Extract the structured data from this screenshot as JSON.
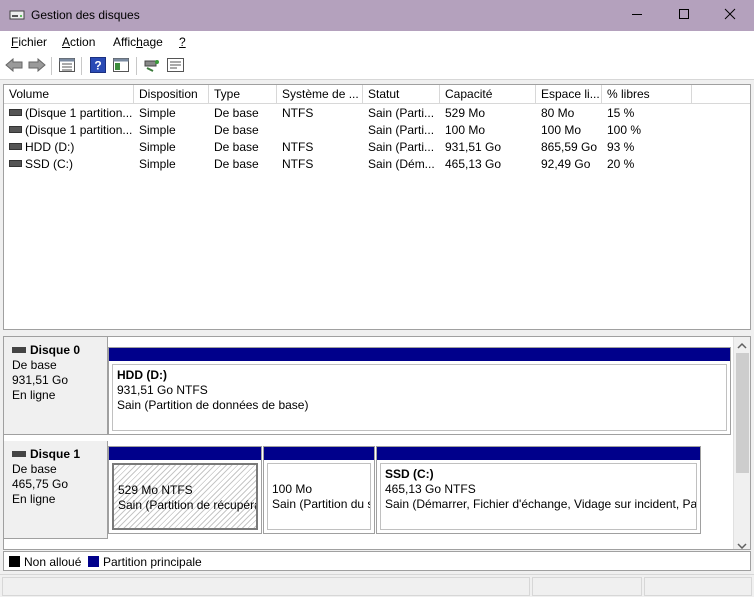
{
  "window": {
    "title": "Gestion des disques",
    "minimize_icon": "minimize-icon",
    "maximize_icon": "maximize-icon",
    "close_icon": "close-icon"
  },
  "menu": {
    "items": [
      {
        "first": "F",
        "rest": "ichier"
      },
      {
        "first": "A",
        "rest": "ction"
      },
      {
        "pre": "Affic",
        "first": "h",
        "rest": "age"
      },
      {
        "first": "?",
        "rest": ""
      }
    ]
  },
  "toolbar": {
    "icons": [
      "back-arrow-icon",
      "forward-arrow-icon",
      "list-view-icon",
      "help-icon",
      "properties-pane-icon",
      "rescan-icon",
      "settings-icon"
    ]
  },
  "volumes": {
    "columns": [
      "Volume",
      "Disposition",
      "Type",
      "Système de ...",
      "Statut",
      "Capacité",
      "Espace li...",
      "% libres"
    ],
    "rows": [
      {
        "volume": "(Disque 1 partition...",
        "disposition": "Simple",
        "type": "De base",
        "fs": "NTFS",
        "status": "Sain (Parti...",
        "capacity": "529 Mo",
        "free": "80 Mo",
        "pct": "15 %"
      },
      {
        "volume": "(Disque 1 partition...",
        "disposition": "Simple",
        "type": "De base",
        "fs": "",
        "status": "Sain (Parti...",
        "capacity": "100 Mo",
        "free": "100 Mo",
        "pct": "100 %"
      },
      {
        "volume": "HDD (D:)",
        "disposition": "Simple",
        "type": "De base",
        "fs": "NTFS",
        "status": "Sain (Parti...",
        "capacity": "931,51 Go",
        "free": "865,59 Go",
        "pct": "93 %"
      },
      {
        "volume": "SSD (C:)",
        "disposition": "Simple",
        "type": "De base",
        "fs": "NTFS",
        "status": "Sain (Dém...",
        "capacity": "465,13 Go",
        "free": "92,49 Go",
        "pct": "20 %"
      }
    ]
  },
  "disks": [
    {
      "name": "Disque 0",
      "kind": "De base",
      "size": "931,51 Go",
      "state": "En ligne",
      "partitions": [
        {
          "title": "HDD  (D:)",
          "size": "931,51 Go NTFS",
          "status": "Sain (Partition de données de base)"
        }
      ]
    },
    {
      "name": "Disque 1",
      "kind": "De base",
      "size": "465,75 Go",
      "state": "En ligne",
      "partitions": [
        {
          "title": "",
          "size": "529 Mo NTFS",
          "status": "Sain (Partition de récupéra"
        },
        {
          "title": "",
          "size": "100 Mo",
          "status": "Sain (Partition du s"
        },
        {
          "title": "SSD  (C:)",
          "size": "465,13 Go NTFS",
          "status": "Sain (Démarrer, Fichier d'échange, Vidage sur incident, Par"
        }
      ]
    }
  ],
  "legend": {
    "unallocated": {
      "label": "Non alloué",
      "color": "#000000"
    },
    "primary": {
      "label": "Partition principale",
      "color": "#00008b"
    }
  },
  "colors": {
    "titlebar": "#b4a1bd",
    "partition_bar": "#00008b"
  }
}
